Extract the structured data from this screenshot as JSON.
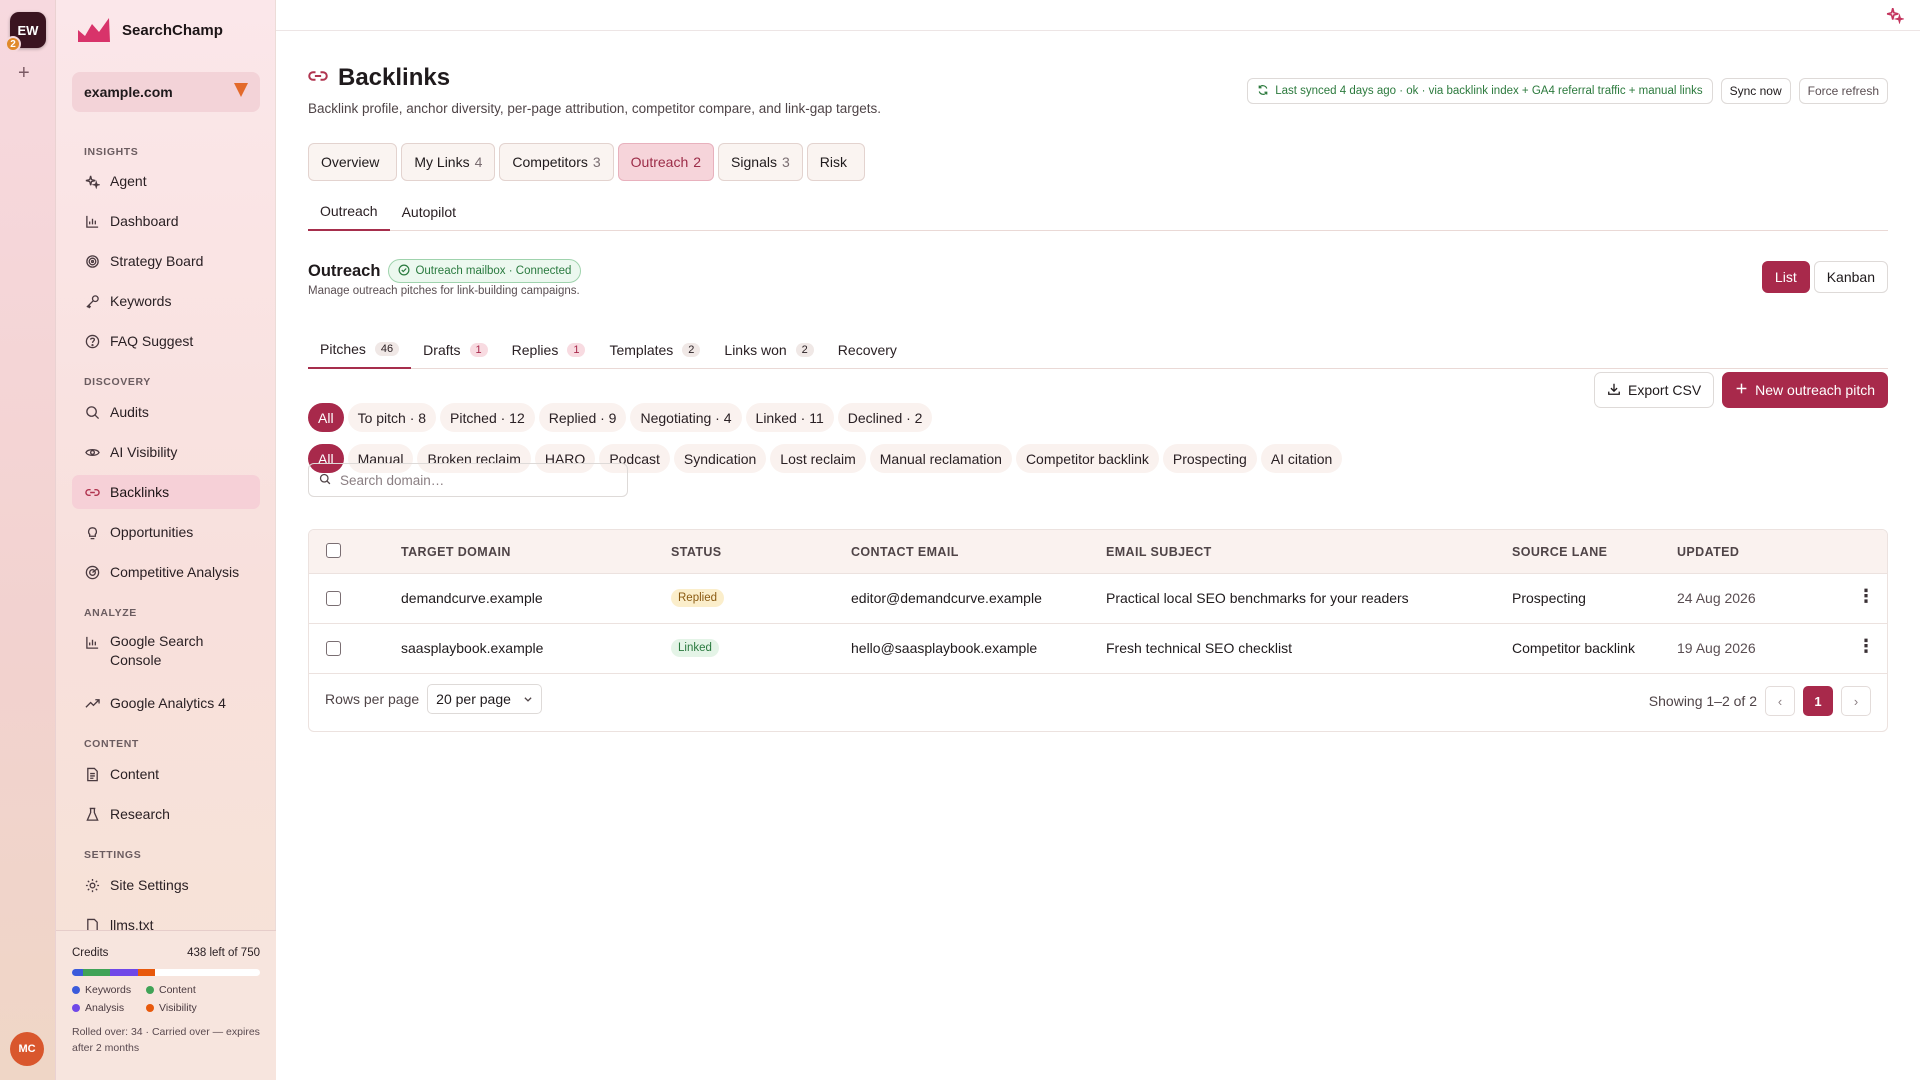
{
  "workspace": {
    "initials": "EW",
    "badge": "2",
    "add": "+",
    "user_initials": "MC"
  },
  "brand": {
    "name": "SearchChamp"
  },
  "site": {
    "domain": "example.com"
  },
  "sidebar": {
    "insights_label": "INSIGHTS",
    "discovery_label": "DISCOVERY",
    "analyze_label": "ANALYZE",
    "content_label": "CONTENT",
    "settings_label": "SETTINGS",
    "items": {
      "agent": "Agent",
      "dashboard": "Dashboard",
      "strategy": "Strategy Board",
      "keywords": "Keywords",
      "faq": "FAQ Suggest",
      "audits": "Audits",
      "ai_visibility": "AI Visibility",
      "backlinks": "Backlinks",
      "opportunities": "Opportunities",
      "competitive": "Competitive Analysis",
      "gsc": "Google Search Console",
      "ga4": "Google Analytics 4",
      "content": "Content",
      "research": "Research",
      "site_settings": "Site Settings",
      "llms": "llms.txt"
    }
  },
  "credits": {
    "label": "Credits",
    "remaining": "438 left of 750",
    "segments": [
      {
        "name": "Keywords",
        "color": "#3b5bdb",
        "fraction": 0.06
      },
      {
        "name": "Content",
        "color": "#40a357",
        "fraction": 0.14
      },
      {
        "name": "Analysis",
        "color": "#7048e8",
        "fraction": 0.15
      },
      {
        "name": "Visibility",
        "color": "#e8590c",
        "fraction": 0.09
      }
    ],
    "legend": {
      "keywords": "Keywords",
      "content": "Content",
      "analysis": "Analysis",
      "visibility": "Visibility"
    },
    "note": "Rolled over: 34 · Carried over — expires after 2 months"
  },
  "page": {
    "title": "Backlinks",
    "subtitle": "Backlink profile, anchor diversity, per-page attribution, competitor compare, and link-gap targets.",
    "sync_status": "Last synced 4 days ago · ok · via backlink index + GA4 referral traffic + manual links",
    "sync_now": "Sync now",
    "force_refresh": "Force refresh"
  },
  "tabs": [
    {
      "label": "Overview",
      "count": ""
    },
    {
      "label": "My Links",
      "count": "4"
    },
    {
      "label": "Competitors",
      "count": "3"
    },
    {
      "label": "Outreach",
      "count": "2"
    },
    {
      "label": "Signals",
      "count": "3"
    },
    {
      "label": "Risk",
      "count": ""
    }
  ],
  "subtabs": {
    "outreach": "Outreach",
    "autopilot": "Autopilot"
  },
  "outreach": {
    "title": "Outreach",
    "mailbox_status": "Outreach mailbox · Connected",
    "description": "Manage outreach pitches for link-building campaigns.",
    "view_list": "List",
    "view_kanban": "Kanban"
  },
  "pitch_tabs": [
    {
      "label": "Pitches",
      "count": "46"
    },
    {
      "label": "Drafts",
      "count": "1"
    },
    {
      "label": "Replies",
      "count": "1"
    },
    {
      "label": "Templates",
      "count": "2"
    },
    {
      "label": "Links won",
      "count": "2"
    },
    {
      "label": "Recovery",
      "count": ""
    }
  ],
  "status_filters": [
    "All",
    "To pitch · 8",
    "Pitched · 12",
    "Replied · 9",
    "Negotiating · 4",
    "Linked · 11",
    "Declined · 2"
  ],
  "lane_filters": [
    "All",
    "Manual",
    "Broken reclaim",
    "HARO",
    "Podcast",
    "Syndication",
    "Lost reclaim",
    "Manual reclamation",
    "Competitor backlink",
    "Prospecting",
    "AI citation"
  ],
  "buttons": {
    "export": "Export CSV",
    "new_pitch": "New outreach pitch"
  },
  "search": {
    "placeholder": "Search domain…"
  },
  "table": {
    "headers": {
      "domain": "TARGET DOMAIN",
      "status": "STATUS",
      "email": "CONTACT EMAIL",
      "subject": "EMAIL SUBJECT",
      "lane": "SOURCE LANE",
      "updated": "UPDATED"
    },
    "rows": [
      {
        "domain": "demandcurve.example",
        "status": "Replied",
        "email": "editor@demandcurve.example",
        "subject": "Practical local SEO benchmarks for your readers",
        "lane": "Prospecting",
        "updated": "24 Aug 2026"
      },
      {
        "domain": "saasplaybook.example",
        "status": "Linked",
        "email": "hello@saasplaybook.example",
        "subject": "Fresh technical SEO checklist",
        "lane": "Competitor backlink",
        "updated": "19 Aug 2026"
      }
    ]
  },
  "pagination": {
    "rows_label": "Rows per page",
    "per_page": "20 per page",
    "showing": "Showing 1–2 of 2",
    "prev": "‹",
    "page": "1",
    "next": "›"
  }
}
